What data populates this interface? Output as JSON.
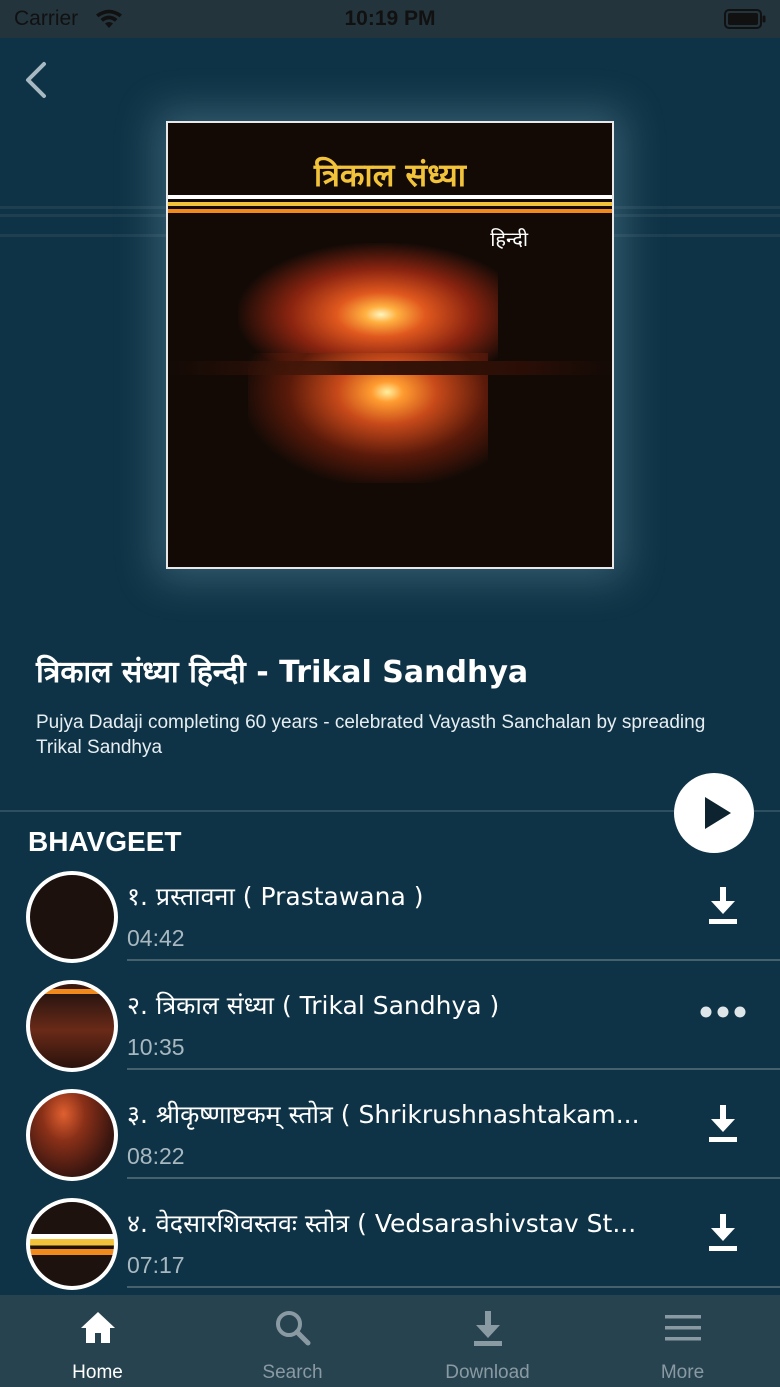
{
  "status_bar": {
    "carrier": "Carrier",
    "time": "10:19 PM"
  },
  "album": {
    "cover_title": "त्रिकाल संध्या",
    "cover_subtitle": "हिन्दी",
    "title": "त्रिकाल संध्या  हिन्दी - Trikal Sandhya",
    "description": "Pujya Dadaji completing 60 years - celebrated Vayasth Sanchalan by spreading Trikal Sandhya"
  },
  "section": {
    "title": "BHAVGEET"
  },
  "tracks": [
    {
      "title": "१. प्रस्तावना ( Prastawana )",
      "duration": "04:42",
      "action": "download-icon"
    },
    {
      "title": "२. त्रिकाल संध्या ( Trikal Sandhya )",
      "duration": "10:35",
      "action": "more-dots-icon"
    },
    {
      "title": "३. श्रीकृष्णाष्टकम् स्तोत्र ( Shrikrushnashtakam...",
      "duration": "08:22",
      "action": "download-icon"
    },
    {
      "title": "४. वेदसारशिवस्तवः स्तोत्र ( Vedsarashivstav St...",
      "duration": "07:17",
      "action": "download-icon"
    }
  ],
  "tab_bar": {
    "tabs": [
      {
        "label": "Home",
        "icon": "home-icon",
        "active": true
      },
      {
        "label": "Search",
        "icon": "search-icon",
        "active": false
      },
      {
        "label": "Download",
        "icon": "download-icon",
        "active": false
      },
      {
        "label": "More",
        "icon": "menu-icon",
        "active": false
      }
    ]
  },
  "colors": {
    "background": "#0f3346",
    "tab_bar": "#274350",
    "cover_title": "#f2c23a",
    "accent_orange": "#f08a1c"
  }
}
